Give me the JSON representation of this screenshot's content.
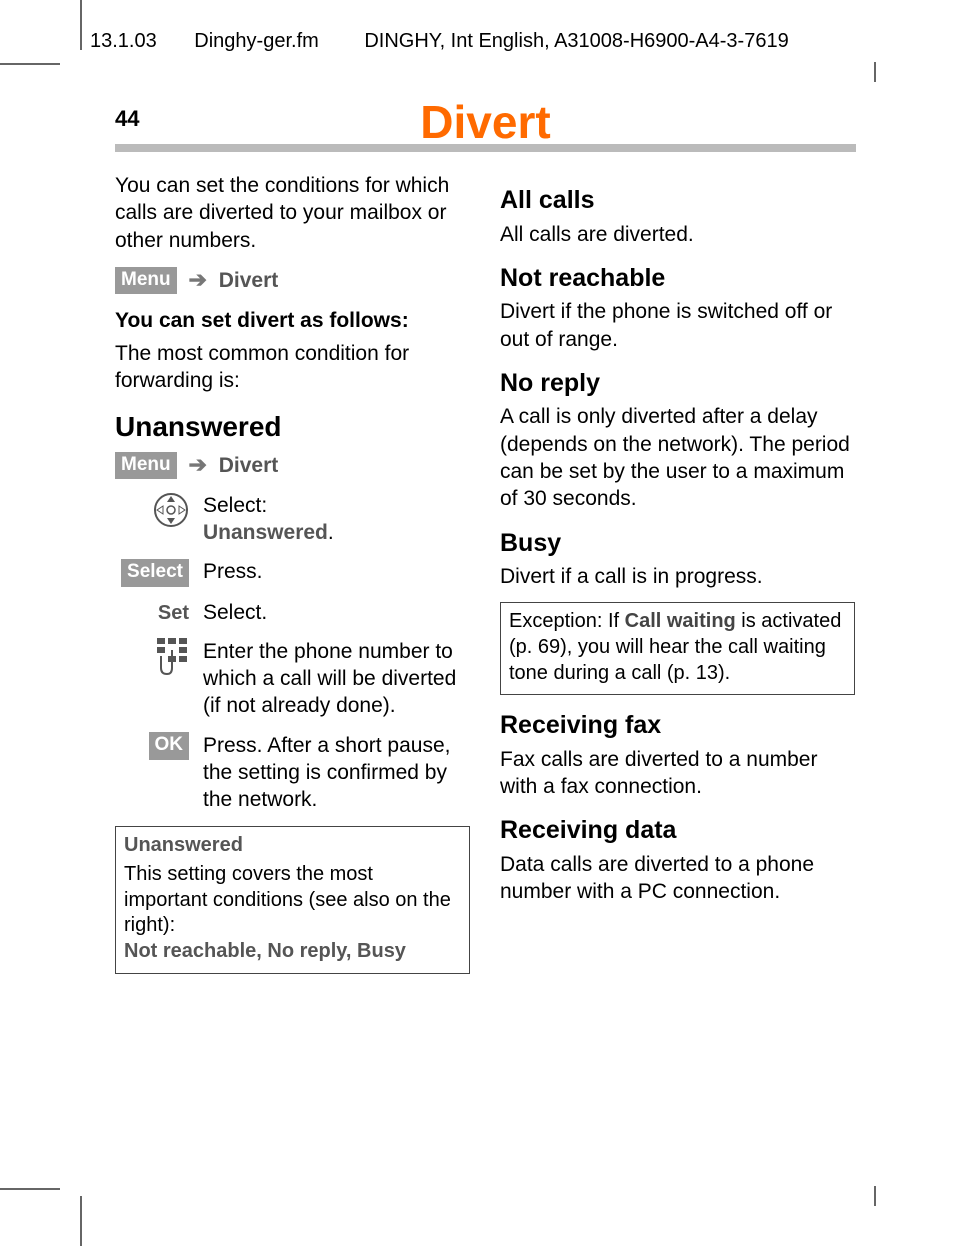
{
  "header": {
    "date": "13.1.03",
    "filename": "Dinghy-ger.fm",
    "docid": "DINGHY, Int English, A31008-H6900-A4-3-7619"
  },
  "page": {
    "number": "44",
    "title": "Divert"
  },
  "left": {
    "intro": "You can set the conditions for which calls are diverted to your mailbox or other numbers.",
    "nav": {
      "menu": "Menu",
      "target": "Divert"
    },
    "follows": "You can set divert as follows:",
    "common": "The most common condition for forwarding is:",
    "h_unanswered": "Unanswered",
    "nav2": {
      "menu": "Menu",
      "target": "Divert"
    },
    "steps": {
      "s1a": "Select:",
      "s1b": "Unanswered",
      "s2_label": "Select",
      "s2_text": "Press.",
      "s3_label": "Set",
      "s3_text": "Select.",
      "s4_text": "Enter the phone number to which a call will be diverted (if not already done).",
      "s5_label": "OK",
      "s5_text": "Press. After a short pause, the setting is confirmed by the network."
    },
    "box": {
      "title": "Unanswered",
      "body": "This setting covers the most important conditions (see also on the right):",
      "sub": "Not reachable, No reply, Busy"
    }
  },
  "right": {
    "h_all": "All calls",
    "p_all": "All calls are diverted.",
    "h_nr": "Not reachable",
    "p_nr": "Divert if the phone is switched off or out of range.",
    "h_noreply": "No reply",
    "p_noreply": "A call is only diverted after a delay (depends on the network). The period can be set by the user to a maximum of 30 seconds.",
    "h_busy": "Busy",
    "p_busy": "Divert if a call is in progress.",
    "box_busy_a": "Exception: If ",
    "box_busy_cw": "Call waiting",
    "box_busy_b": " is activated (p. 69), you will hear the call waiting tone during a call (p. 13).",
    "h_fax": "Receiving fax",
    "p_fax": "Fax calls are diverted to a number with a fax connection.",
    "h_data": "Receiving data",
    "p_data": "Data calls are diverted to a phone number with a PC connection."
  }
}
